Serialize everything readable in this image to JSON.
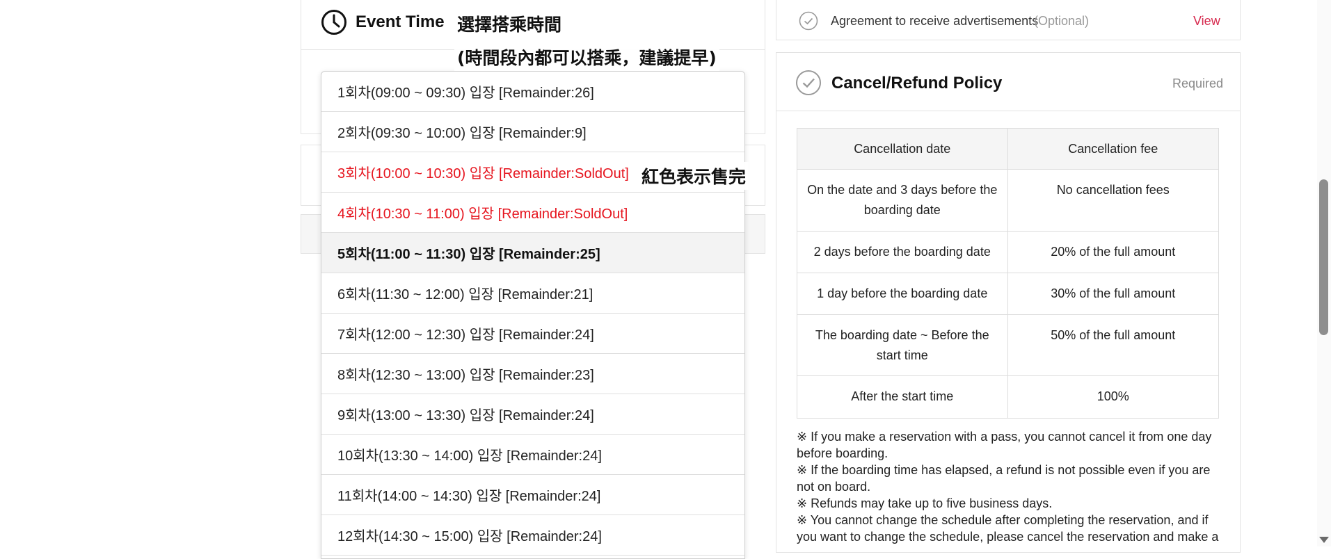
{
  "event_section": {
    "title": "Event Time",
    "selected_index": 4,
    "options": [
      {
        "label": "1회차(09:00 ~ 09:30) 입장 [Remainder:26]",
        "status": "available"
      },
      {
        "label": "2회차(09:30 ~ 10:00) 입장 [Remainder:9]",
        "status": "available"
      },
      {
        "label": "3회차(10:00 ~ 10:30) 입장 [Remainder:SoldOut]",
        "status": "soldout"
      },
      {
        "label": "4회차(10:30 ~ 11:00) 입장 [Remainder:SoldOut]",
        "status": "soldout"
      },
      {
        "label": "5회차(11:00 ~ 11:30) 입장 [Remainder:25]",
        "status": "selected"
      },
      {
        "label": "6회차(11:30 ~ 12:00) 입장 [Remainder:21]",
        "status": "available"
      },
      {
        "label": "7회차(12:00 ~ 12:30) 입장 [Remainder:24]",
        "status": "available"
      },
      {
        "label": "8회차(12:30 ~ 13:00) 입장 [Remainder:23]",
        "status": "available"
      },
      {
        "label": "9회차(13:00 ~ 13:30) 입장 [Remainder:24]",
        "status": "available"
      },
      {
        "label": "10회차(13:30 ~ 14:00) 입장 [Remainder:24]",
        "status": "available"
      },
      {
        "label": "11회차(14:00 ~ 14:30) 입장 [Remainder:24]",
        "status": "available"
      },
      {
        "label": "12회차(14:30 ~ 15:00) 입장 [Remainder:24]",
        "status": "available"
      }
    ]
  },
  "annotations": {
    "select_time": "選擇搭乘時間",
    "hint": "(時間段內都可以搭乘，建議提早)",
    "soldout_note": "紅色表示售完"
  },
  "agreement": {
    "text": "Agreement to receive advertisements",
    "optional": "(Optional)",
    "view_link": "View"
  },
  "policy": {
    "title": "Cancel/Refund Policy",
    "required": "Required",
    "table": {
      "headers": [
        "Cancellation date",
        "Cancellation fee"
      ],
      "rows": [
        [
          "On the date and 3 days before the boarding date",
          "No cancellation fees"
        ],
        [
          "2 days before the boarding date",
          "20% of the full amount"
        ],
        [
          "1 day before the boarding date",
          "30% of the full amount"
        ],
        [
          "The boarding date ~ Before the start time",
          "50% of the full amount"
        ],
        [
          "After the start time",
          "100%"
        ]
      ]
    },
    "notes": [
      "※ If you make a reservation with a pass, you cannot cancel it from one day before boarding.",
      "※ If the boarding time has elapsed, a refund is not possible even if you are not on board.",
      "※ Refunds may take up to five business days.",
      "※ You cannot change the schedule after completing the reservation, and if you want to change the schedule, please cancel the reservation and make a"
    ]
  },
  "colors": {
    "soldout": "#e6141e",
    "link": "#d6294d",
    "selected_bg": "#f3f3f3"
  }
}
